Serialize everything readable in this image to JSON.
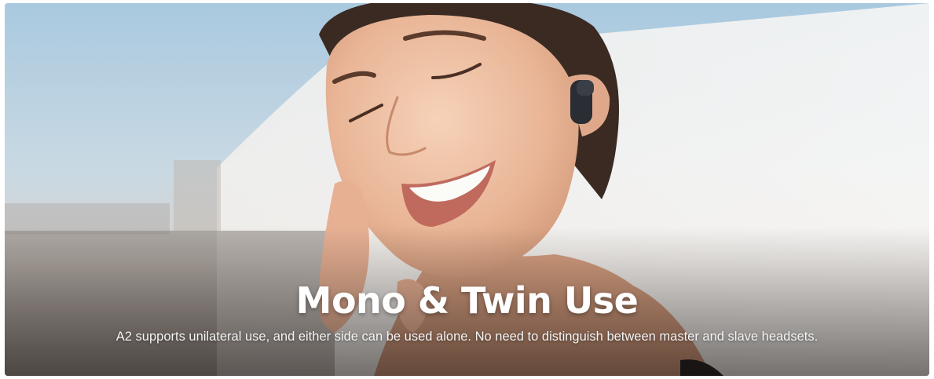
{
  "banner": {
    "title": "Mono & Twin Use",
    "description": "A2 supports unilateral use, and either side can be used alone. No need to distinguish between master and slave headsets."
  },
  "image": {
    "subject": "woman-with-earbud-icon"
  }
}
